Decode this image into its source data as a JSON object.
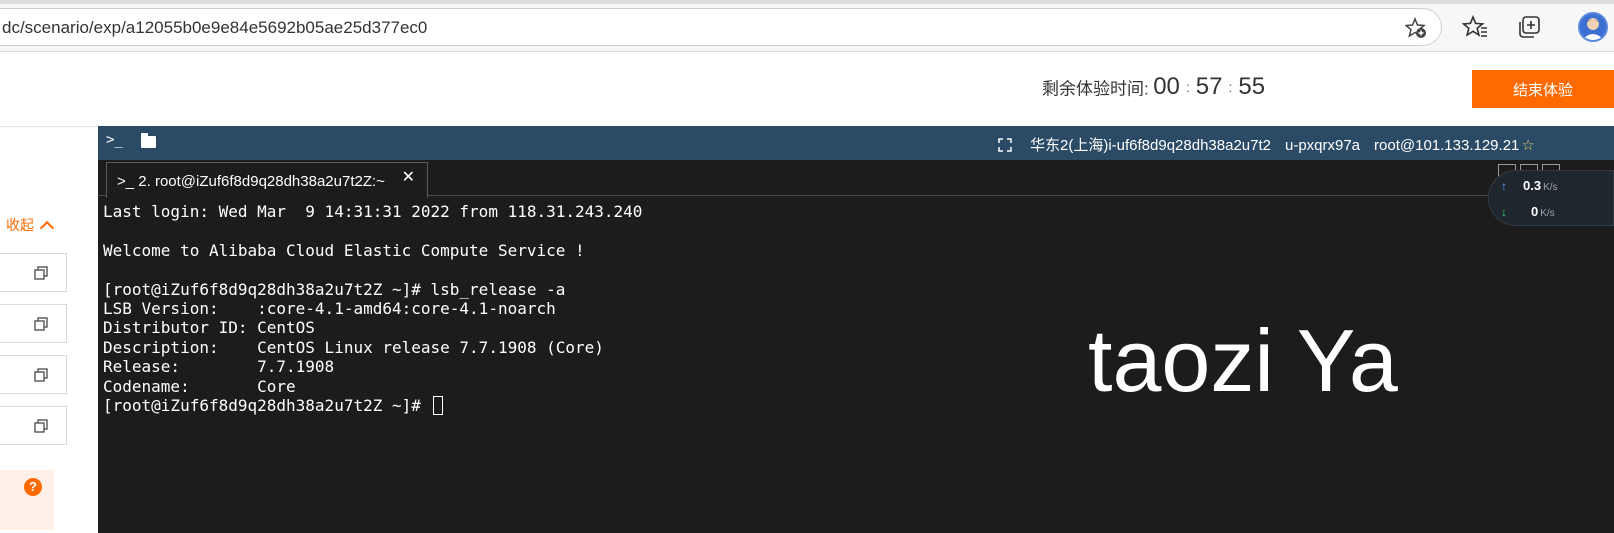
{
  "browser": {
    "url": "dc/scenario/exp/a12055b0e9e84e5692b05ae25d377ec0",
    "icons": [
      "favorites-add-icon",
      "favorites-icon",
      "collections-icon",
      "profile-avatar"
    ]
  },
  "header": {
    "timer_label": "剩余体验时间:",
    "timer": {
      "hours": "00",
      "minutes": "57",
      "seconds": "55",
      "separator": ":"
    },
    "end_button": "结束体验"
  },
  "sidebar": {
    "collapse_label": "收起",
    "copy_items": 4,
    "help": "?"
  },
  "terminal": {
    "toolbar": {
      "prompt_glyph": ">_",
      "region": "华东2(上海)i-uf6f8d9q28dh38a2u7t2",
      "user": "u-pxqrx97a",
      "login": "root@101.133.129.21",
      "extra": "☆"
    },
    "tab": {
      "label": ">_ 2. root@iZuf6f8d9q28dh38a2u7t2Z:~",
      "close": "✕"
    },
    "speed": {
      "up_value": "0.3",
      "up_unit": "K/s",
      "down_value": "0",
      "down_unit": "K/s"
    },
    "lines": [
      "Last login: Wed Mar  9 14:31:31 2022 from 118.31.243.240",
      "",
      "Welcome to Alibaba Cloud Elastic Compute Service !",
      "",
      "[root@iZuf6f8d9q28dh38a2u7t2Z ~]# lsb_release -a",
      "LSB Version:    :core-4.1-amd64:core-4.1-noarch",
      "Distributor ID: CentOS",
      "Description:    CentOS Linux release 7.7.1908 (Core)",
      "Release:        7.7.1908",
      "Codename:       Core"
    ],
    "prompt": "[root@iZuf6f8d9q28dh38a2u7t2Z ~]# "
  },
  "watermark": "taozi Ya",
  "colors": {
    "accent": "#ff6a00",
    "terminal_bg": "#1c1c1c",
    "terminal_bar": "#2b4a66"
  }
}
